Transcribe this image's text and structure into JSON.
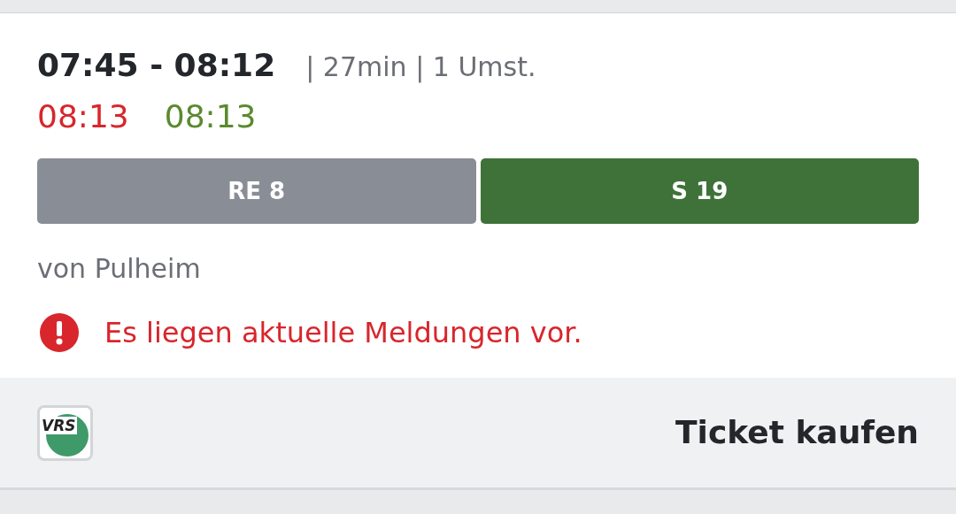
{
  "connection": {
    "time_range": "07:45 - 08:12",
    "details": "| 27min | 1 Umst.",
    "realtime": [
      {
        "text": "08:13",
        "kind": "delayed"
      },
      {
        "text": "08:13",
        "kind": "on_time"
      }
    ],
    "legs": [
      {
        "label": "RE 8",
        "color": "#898d96"
      },
      {
        "label": "S 19",
        "color": "#3f7239"
      }
    ],
    "origin": "von Pulheim",
    "alert": "Es liegen aktuelle Meldungen vor."
  },
  "footer": {
    "logo": "VRS",
    "button": "Ticket kaufen"
  }
}
